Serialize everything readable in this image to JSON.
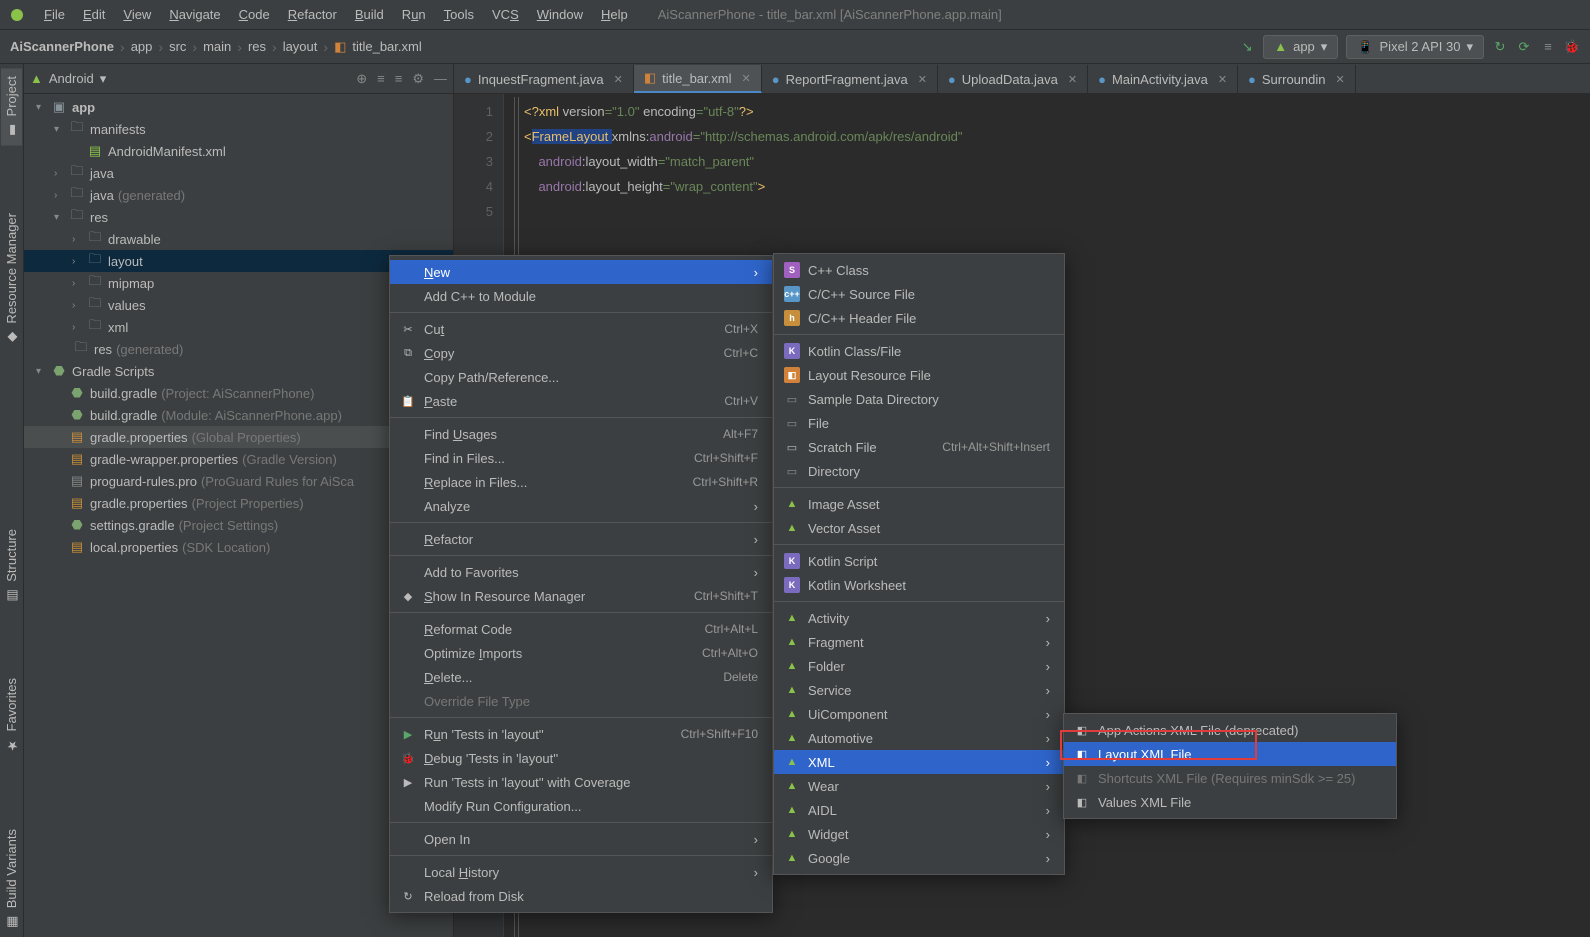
{
  "window_title": "AiScannerPhone - title_bar.xml [AiScannerPhone.app.main]",
  "menubar": [
    "File",
    "Edit",
    "View",
    "Navigate",
    "Code",
    "Refactor",
    "Build",
    "Run",
    "Tools",
    "VCS",
    "Window",
    "Help"
  ],
  "breadcrumbs": [
    "AiScannerPhone",
    "app",
    "src",
    "main",
    "res",
    "layout",
    "title_bar.xml"
  ],
  "run_config": "app",
  "device": "Pixel 2 API 30",
  "pane_title": "Android",
  "tree": {
    "app": "app",
    "manifests": "manifests",
    "manifest_file": "AndroidManifest.xml",
    "java": "java",
    "java_gen": "java",
    "java_gen_suffix": "(generated)",
    "res": "res",
    "drawable": "drawable",
    "layout": "layout",
    "mipmap": "mipmap",
    "values": "values",
    "xml": "xml",
    "res_gen": "res",
    "res_gen_suffix": "(generated)",
    "gradle_scripts": "Gradle Scripts",
    "bg1": "build.gradle",
    "bg1s": "(Project: AiScannerPhone)",
    "bg2": "build.gradle",
    "bg2s": "(Module: AiScannerPhone.app)",
    "gp1": "gradle.properties",
    "gp1s": "(Global Properties)",
    "gw": "gradle-wrapper.properties",
    "gws": "(Gradle Version)",
    "pg": "proguard-rules.pro",
    "pgs": "(ProGuard Rules for AiSca",
    "gp2": "gradle.properties",
    "gp2s": "(Project Properties)",
    "sg": "settings.gradle",
    "sgs": "(Project Settings)",
    "lp": "local.properties",
    "lps": "(SDK Location)"
  },
  "tabs": [
    {
      "label": "InquestFragment.java",
      "type": "java"
    },
    {
      "label": "title_bar.xml",
      "type": "xml",
      "active": true
    },
    {
      "label": "ReportFragment.java",
      "type": "java"
    },
    {
      "label": "UploadData.java",
      "type": "java"
    },
    {
      "label": "MainActivity.java",
      "type": "java"
    },
    {
      "label": "Surroundin",
      "type": "java"
    }
  ],
  "code": {
    "l1a": "<?xml ",
    "l1b": "version",
    "l1c": "=\"1.0\" ",
    "l1d": "encoding",
    "l1e": "=\"utf-8\"",
    "l1f": "?>",
    "l2a": "<",
    "l2b": "FrameLayout ",
    "l2c": "xmlns:",
    "l2d": "android",
    "l2e": "=\"http://schemas.android.com/apk/res/android\"",
    "l3a": "android",
    "l3b": ":layout_width",
    "l3c": "=\"match_parent\"",
    "l4a": "android",
    "l4b": ":layout_height",
    "l4c": "=\"wrap_content\"",
    "l4d": ">"
  },
  "ctx1": [
    {
      "label": "New",
      "sel": true,
      "arrow": true,
      "u": 0
    },
    {
      "label": "Add C++ to Module"
    },
    {
      "sep": true
    },
    {
      "label": "Cut",
      "sc": "Ctrl+X",
      "icon": "✂",
      "u": 2
    },
    {
      "label": "Copy",
      "sc": "Ctrl+C",
      "icon": "⧉",
      "u": 0
    },
    {
      "label": "Copy Path/Reference..."
    },
    {
      "label": "Paste",
      "sc": "Ctrl+V",
      "icon": "📋",
      "u": 0
    },
    {
      "sep": true
    },
    {
      "label": "Find Usages",
      "sc": "Alt+F7",
      "u": 5
    },
    {
      "label": "Find in Files...",
      "sc": "Ctrl+Shift+F"
    },
    {
      "label": "Replace in Files...",
      "sc": "Ctrl+Shift+R",
      "u": 0
    },
    {
      "label": "Analyze",
      "arrow": true
    },
    {
      "sep": true
    },
    {
      "label": "Refactor",
      "arrow": true,
      "u": 0
    },
    {
      "sep": true
    },
    {
      "label": "Add to Favorites",
      "arrow": true
    },
    {
      "label": "Show In Resource Manager",
      "sc": "Ctrl+Shift+T",
      "icon": "◆",
      "u": 0
    },
    {
      "sep": true
    },
    {
      "label": "Reformat Code",
      "sc": "Ctrl+Alt+L",
      "u": 0
    },
    {
      "label": "Optimize Imports",
      "sc": "Ctrl+Alt+O",
      "u": 9
    },
    {
      "label": "Delete...",
      "sc": "Delete",
      "u": 0
    },
    {
      "label": "Override File Type",
      "dis": true
    },
    {
      "sep": true
    },
    {
      "label": "Run 'Tests in 'layout''",
      "sc": "Ctrl+Shift+F10",
      "icon": "▶",
      "iconColor": "#59a869",
      "u": 1
    },
    {
      "label": "Debug 'Tests in 'layout''",
      "icon": "🐞",
      "u": 0
    },
    {
      "label": "Run 'Tests in 'layout'' with Coverage",
      "icon": "▶"
    },
    {
      "label": "Modify Run Configuration..."
    },
    {
      "sep": true
    },
    {
      "label": "Open In",
      "arrow": true
    },
    {
      "sep": true
    },
    {
      "label": "Local History",
      "arrow": true,
      "u": 6
    },
    {
      "label": "Reload from Disk",
      "icon": "↻"
    }
  ],
  "ctx2": [
    {
      "label": "C++ Class",
      "icon": "S",
      "iconBg": "#a060c0"
    },
    {
      "label": "C/C++ Source File",
      "icon": "c++",
      "iconBg": "#5896c7"
    },
    {
      "label": "C/C++ Header File",
      "icon": "h",
      "iconBg": "#c78f3c"
    },
    {
      "sep": true
    },
    {
      "label": "Kotlin Class/File",
      "icon": "K",
      "iconBg": "#7b6bbf"
    },
    {
      "label": "Layout Resource File",
      "icon": "◧",
      "iconBg": "#d0823a"
    },
    {
      "label": "Sample Data Directory",
      "icon": "▭",
      "iconColor": "#87939a"
    },
    {
      "label": "File",
      "icon": "▭",
      "iconColor": "#87939a"
    },
    {
      "label": "Scratch File",
      "sc": "Ctrl+Alt+Shift+Insert",
      "icon": "▭"
    },
    {
      "label": "Directory",
      "icon": "▭",
      "iconColor": "#87939a"
    },
    {
      "sep": true
    },
    {
      "label": "Image Asset",
      "icon": "▲",
      "iconColor": "#8bc34a"
    },
    {
      "label": "Vector Asset",
      "icon": "▲",
      "iconColor": "#8bc34a"
    },
    {
      "sep": true
    },
    {
      "label": "Kotlin Script",
      "icon": "K",
      "iconBg": "#7b6bbf"
    },
    {
      "label": "Kotlin Worksheet",
      "icon": "K",
      "iconBg": "#7b6bbf"
    },
    {
      "sep": true
    },
    {
      "label": "Activity",
      "arrow": true,
      "icon": "▲",
      "iconColor": "#8bc34a"
    },
    {
      "label": "Fragment",
      "arrow": true,
      "icon": "▲",
      "iconColor": "#8bc34a"
    },
    {
      "label": "Folder",
      "arrow": true,
      "icon": "▲",
      "iconColor": "#8bc34a"
    },
    {
      "label": "Service",
      "arrow": true,
      "icon": "▲",
      "iconColor": "#8bc34a"
    },
    {
      "label": "UiComponent",
      "arrow": true,
      "icon": "▲",
      "iconColor": "#8bc34a"
    },
    {
      "label": "Automotive",
      "arrow": true,
      "icon": "▲",
      "iconColor": "#8bc34a"
    },
    {
      "label": "XML",
      "arrow": true,
      "sel": true,
      "icon": "▲",
      "iconColor": "#8bc34a"
    },
    {
      "label": "Wear",
      "arrow": true,
      "icon": "▲",
      "iconColor": "#8bc34a"
    },
    {
      "label": "AIDL",
      "arrow": true,
      "icon": "▲",
      "iconColor": "#8bc34a"
    },
    {
      "label": "Widget",
      "arrow": true,
      "icon": "▲",
      "iconColor": "#8bc34a"
    },
    {
      "label": "Google",
      "arrow": true,
      "icon": "▲",
      "iconColor": "#8bc34a"
    }
  ],
  "ctx3": [
    {
      "label": "App Actions XML File (deprecated)",
      "icon": "◧"
    },
    {
      "label": "Layout XML File",
      "sel": true,
      "icon": "◧"
    },
    {
      "label": "Shortcuts XML File (Requires minSdk >= 25)",
      "dis": true,
      "icon": "◧"
    },
    {
      "label": "Values XML File",
      "icon": "◧"
    }
  ],
  "sidebar_tabs": {
    "project": "Project",
    "resource_manager": "Resource Manager",
    "structure": "Structure",
    "favorites": "Favorites",
    "build_variants": "Build Variants"
  }
}
